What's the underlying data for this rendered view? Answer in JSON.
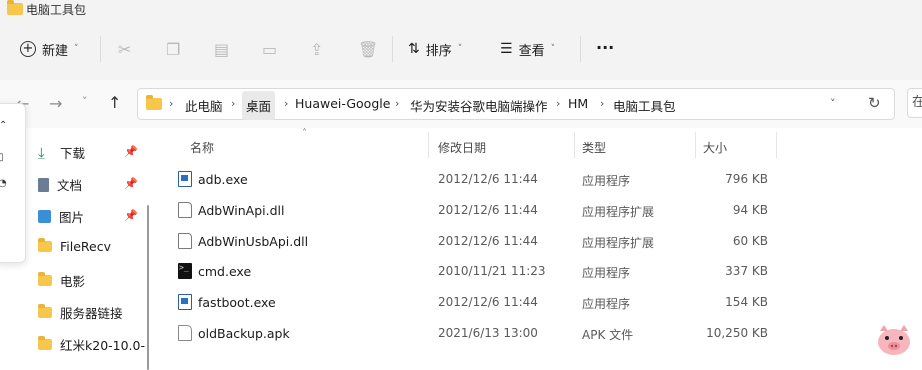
{
  "window": {
    "title": "电脑工具包"
  },
  "toolbar": {
    "new_label": "新建",
    "sort_label": "排序",
    "view_label": "查看",
    "more_label": "···"
  },
  "address": {
    "crumbs": [
      "此电脑",
      "桌面",
      "Huawei-Google",
      "华为安装谷歌电脑端操作",
      "HM",
      "电脑工具包"
    ],
    "search_stub": "在"
  },
  "sidebar": {
    "items": [
      {
        "label": "下载",
        "icon": "download-icon",
        "pinned": true
      },
      {
        "label": "文档",
        "icon": "document-icon",
        "pinned": true
      },
      {
        "label": "图片",
        "icon": "picture-icon",
        "pinned": true
      },
      {
        "label": "FileRecv",
        "icon": "folder-icon",
        "pinned": false
      },
      {
        "label": "电影",
        "icon": "folder-icon",
        "pinned": false
      },
      {
        "label": "服务器链接",
        "icon": "folder-icon",
        "pinned": false
      },
      {
        "label": "红米k20-10.0-",
        "icon": "folder-icon",
        "pinned": false
      }
    ]
  },
  "list": {
    "columns": {
      "name": "名称",
      "date": "修改日期",
      "type": "类型",
      "size": "大小"
    },
    "files": [
      {
        "name": "adb.exe",
        "date": "2012/12/6 11:44",
        "type": "应用程序",
        "size": "796 KB",
        "icon": "exe-icon"
      },
      {
        "name": "AdbWinApi.dll",
        "date": "2012/12/6 11:44",
        "type": "应用程序扩展",
        "size": "94 KB",
        "icon": "dll-icon"
      },
      {
        "name": "AdbWinUsbApi.dll",
        "date": "2012/12/6 11:44",
        "type": "应用程序扩展",
        "size": "60 KB",
        "icon": "dll-icon"
      },
      {
        "name": "cmd.exe",
        "date": "2010/11/21 11:23",
        "type": "应用程序",
        "size": "337 KB",
        "icon": "cmd-icon"
      },
      {
        "name": "fastboot.exe",
        "date": "2012/12/6 11:44",
        "type": "应用程序",
        "size": "154 KB",
        "icon": "exe-icon"
      },
      {
        "name": "oldBackup.apk",
        "date": "2021/6/13 13:00",
        "type": "APK 文件",
        "size": "10,250 KB",
        "icon": "apk-icon"
      }
    ]
  },
  "colors": {
    "folder": "#f7c64b",
    "accent": "#2b6fc4",
    "chrome": "#f3f3f3"
  }
}
